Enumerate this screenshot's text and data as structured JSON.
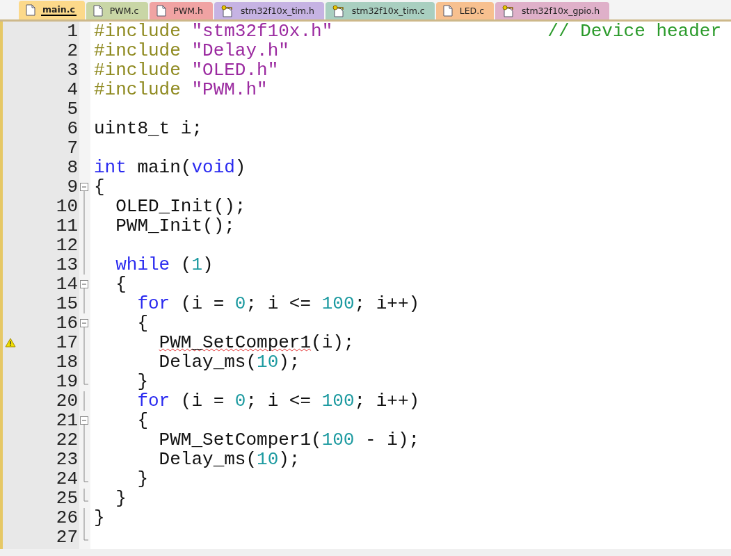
{
  "tabs": [
    {
      "label": "main.c",
      "kind": "file",
      "color": "#fcd98a",
      "selected": true
    },
    {
      "label": "PWM.c",
      "kind": "file",
      "color": "#c9d6a6",
      "selected": false
    },
    {
      "label": "PWM.h",
      "kind": "file",
      "color": "#f0a3a3",
      "selected": false
    },
    {
      "label": "stm32f10x_tim.h",
      "kind": "key",
      "color": "#c6b3e3",
      "selected": false
    },
    {
      "label": "stm32f10x_tim.c",
      "kind": "key",
      "color": "#a9cfc0",
      "selected": false
    },
    {
      "label": "LED.c",
      "kind": "file",
      "color": "#f7c08f",
      "selected": false
    },
    {
      "label": "stm32f10x_gpio.h",
      "kind": "key",
      "color": "#dfb0c9",
      "selected": false
    }
  ],
  "lines": [
    {
      "number": "1",
      "kind": "plain",
      "warning": false,
      "tokens": [
        {
          "kind": "pp",
          "text": "#include "
        },
        {
          "kind": "str",
          "text": "\"stm32f10x.h\""
        },
        {
          "kind": "cmt",
          "text": "// Device header"
        }
      ]
    },
    {
      "number": "2",
      "kind": "plain",
      "warning": false,
      "tokens": [
        {
          "kind": "pp",
          "text": "#include "
        },
        {
          "kind": "str",
          "text": "\"Delay.h\""
        }
      ]
    },
    {
      "number": "3",
      "kind": "plain",
      "warning": false,
      "tokens": [
        {
          "kind": "pp",
          "text": "#include "
        },
        {
          "kind": "str",
          "text": "\"OLED.h\""
        }
      ]
    },
    {
      "number": "4",
      "kind": "plain",
      "warning": false,
      "tokens": [
        {
          "kind": "pp",
          "text": "#include "
        },
        {
          "kind": "str",
          "text": "\"PWM.h\""
        }
      ]
    },
    {
      "number": "5",
      "kind": "plain",
      "warning": false
    },
    {
      "number": "6",
      "kind": "plain",
      "warning": false,
      "tokens": [
        {
          "kind": "plain",
          "text": "uint8_t i;"
        }
      ]
    },
    {
      "number": "7",
      "kind": "plain",
      "warning": false
    },
    {
      "number": "8",
      "kind": "plain",
      "warning": false,
      "tokens": [
        {
          "kind": "kw",
          "text": "int"
        },
        {
          "kind": "plain",
          "text": " main("
        },
        {
          "kind": "kw",
          "text": "void"
        },
        {
          "kind": "plain",
          "text": ")"
        }
      ]
    },
    {
      "number": "9",
      "kind": "fold-start",
      "warning": false,
      "tokens": [
        {
          "kind": "plain",
          "text": "{"
        }
      ]
    },
    {
      "number": "10",
      "kind": "fold-body",
      "warning": false,
      "tokens": [
        {
          "kind": "plain",
          "text": "  OLED_Init();"
        }
      ]
    },
    {
      "number": "11",
      "kind": "fold-body",
      "warning": false,
      "tokens": [
        {
          "kind": "plain",
          "text": "  PWM_Init();"
        }
      ]
    },
    {
      "number": "12",
      "kind": "fold-body",
      "warning": false
    },
    {
      "number": "13",
      "kind": "fold-body",
      "warning": false,
      "tokens": [
        {
          "kind": "kw",
          "text": "  while"
        },
        {
          "kind": "plain",
          "text": " ("
        },
        {
          "kind": "num",
          "text": "1"
        },
        {
          "kind": "plain",
          "text": ")"
        }
      ]
    },
    {
      "number": "14",
      "kind": "fold-start",
      "warning": false,
      "tokens": [
        {
          "kind": "plain",
          "text": "  {"
        }
      ]
    },
    {
      "number": "15",
      "kind": "fold-body",
      "warning": false,
      "tokens": [
        {
          "kind": "kw",
          "text": "    for"
        },
        {
          "kind": "plain",
          "text": " (i = "
        },
        {
          "kind": "num",
          "text": "0"
        },
        {
          "kind": "plain",
          "text": "; i <= "
        },
        {
          "kind": "num",
          "text": "100"
        },
        {
          "kind": "plain",
          "text": "; i++)"
        }
      ]
    },
    {
      "number": "16",
      "kind": "fold-start",
      "warning": false,
      "tokens": [
        {
          "kind": "plain",
          "text": "    {"
        }
      ]
    },
    {
      "number": "17",
      "kind": "fold-body",
      "warning": true,
      "tokens": [
        {
          "kind": "err",
          "text": "      PWM_SetComper1"
        },
        {
          "kind": "plain",
          "text": "(i);"
        }
      ]
    },
    {
      "number": "18",
      "kind": "fold-body",
      "warning": false,
      "tokens": [
        {
          "kind": "plain",
          "text": "      Delay_ms("
        },
        {
          "kind": "num",
          "text": "10"
        },
        {
          "kind": "plain",
          "text": ");"
        }
      ]
    },
    {
      "number": "19",
      "kind": "fold-end",
      "warning": false,
      "tokens": [
        {
          "kind": "plain",
          "text": "    }"
        }
      ]
    },
    {
      "number": "20",
      "kind": "fold-body",
      "warning": false,
      "tokens": [
        {
          "kind": "kw",
          "text": "    for"
        },
        {
          "kind": "plain",
          "text": " (i = "
        },
        {
          "kind": "num",
          "text": "0"
        },
        {
          "kind": "plain",
          "text": "; i <= "
        },
        {
          "kind": "num",
          "text": "100"
        },
        {
          "kind": "plain",
          "text": "; i++)"
        }
      ]
    },
    {
      "number": "21",
      "kind": "fold-start",
      "warning": false,
      "tokens": [
        {
          "kind": "plain",
          "text": "    {"
        }
      ]
    },
    {
      "number": "22",
      "kind": "fold-body",
      "warning": false,
      "tokens": [
        {
          "kind": "plain",
          "text": "      PWM_SetComper1("
        },
        {
          "kind": "num",
          "text": "100"
        },
        {
          "kind": "plain",
          "text": " - i);"
        }
      ]
    },
    {
      "number": "23",
      "kind": "fold-body",
      "warning": false,
      "tokens": [
        {
          "kind": "plain",
          "text": "      Delay_ms("
        },
        {
          "kind": "num",
          "text": "10"
        },
        {
          "kind": "plain",
          "text": ");"
        }
      ]
    },
    {
      "number": "24",
      "kind": "fold-end",
      "warning": false,
      "tokens": [
        {
          "kind": "plain",
          "text": "    }"
        }
      ]
    },
    {
      "number": "25",
      "kind": "fold-end",
      "warning": false,
      "tokens": [
        {
          "kind": "plain",
          "text": "  }"
        }
      ]
    },
    {
      "number": "26",
      "kind": "fold-body",
      "warning": false,
      "tokens": [
        {
          "kind": "plain",
          "text": "}"
        }
      ]
    },
    {
      "number": "27",
      "kind": "fold-end",
      "warning": false
    }
  ]
}
